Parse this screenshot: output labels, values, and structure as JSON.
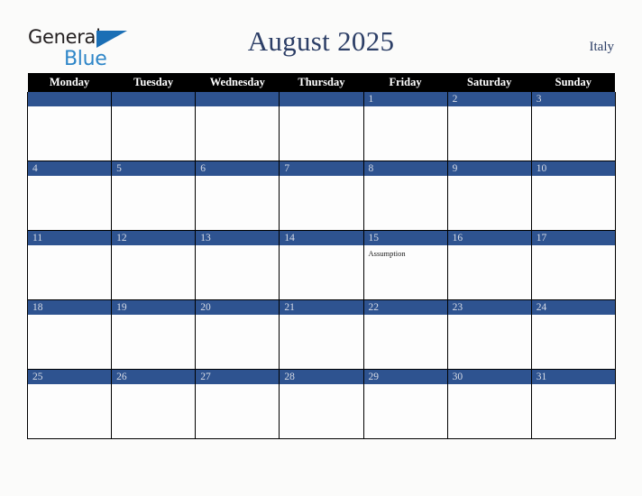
{
  "brand": {
    "name_part1": "General",
    "name_part2": "Blue",
    "triangle_color": "#1b6fb5",
    "blue_color": "#2e86c8",
    "dark_color": "#231f20"
  },
  "header": {
    "title": "August 2025",
    "region": "Italy",
    "title_color": "#2c3e66"
  },
  "calendar": {
    "weekday_headers": [
      "Monday",
      "Tuesday",
      "Wednesday",
      "Thursday",
      "Friday",
      "Saturday",
      "Sunday"
    ],
    "header_bg": "#000000",
    "header_text_color": "#ffffff",
    "day_bar_color": "#2e5390",
    "day_number_color": "#d8dce6",
    "cell_bg": "#fdfdfd",
    "border_color": "#000000",
    "weeks": [
      [
        {
          "date": "",
          "events": []
        },
        {
          "date": "",
          "events": []
        },
        {
          "date": "",
          "events": []
        },
        {
          "date": "",
          "events": []
        },
        {
          "date": "1",
          "events": []
        },
        {
          "date": "2",
          "events": []
        },
        {
          "date": "3",
          "events": []
        }
      ],
      [
        {
          "date": "4",
          "events": []
        },
        {
          "date": "5",
          "events": []
        },
        {
          "date": "6",
          "events": []
        },
        {
          "date": "7",
          "events": []
        },
        {
          "date": "8",
          "events": []
        },
        {
          "date": "9",
          "events": []
        },
        {
          "date": "10",
          "events": []
        }
      ],
      [
        {
          "date": "11",
          "events": []
        },
        {
          "date": "12",
          "events": []
        },
        {
          "date": "13",
          "events": []
        },
        {
          "date": "14",
          "events": []
        },
        {
          "date": "15",
          "events": [
            "Assumption"
          ]
        },
        {
          "date": "16",
          "events": []
        },
        {
          "date": "17",
          "events": []
        }
      ],
      [
        {
          "date": "18",
          "events": []
        },
        {
          "date": "19",
          "events": []
        },
        {
          "date": "20",
          "events": []
        },
        {
          "date": "21",
          "events": []
        },
        {
          "date": "22",
          "events": []
        },
        {
          "date": "23",
          "events": []
        },
        {
          "date": "24",
          "events": []
        }
      ],
      [
        {
          "date": "25",
          "events": []
        },
        {
          "date": "26",
          "events": []
        },
        {
          "date": "27",
          "events": []
        },
        {
          "date": "28",
          "events": []
        },
        {
          "date": "29",
          "events": []
        },
        {
          "date": "30",
          "events": []
        },
        {
          "date": "31",
          "events": []
        }
      ]
    ]
  }
}
